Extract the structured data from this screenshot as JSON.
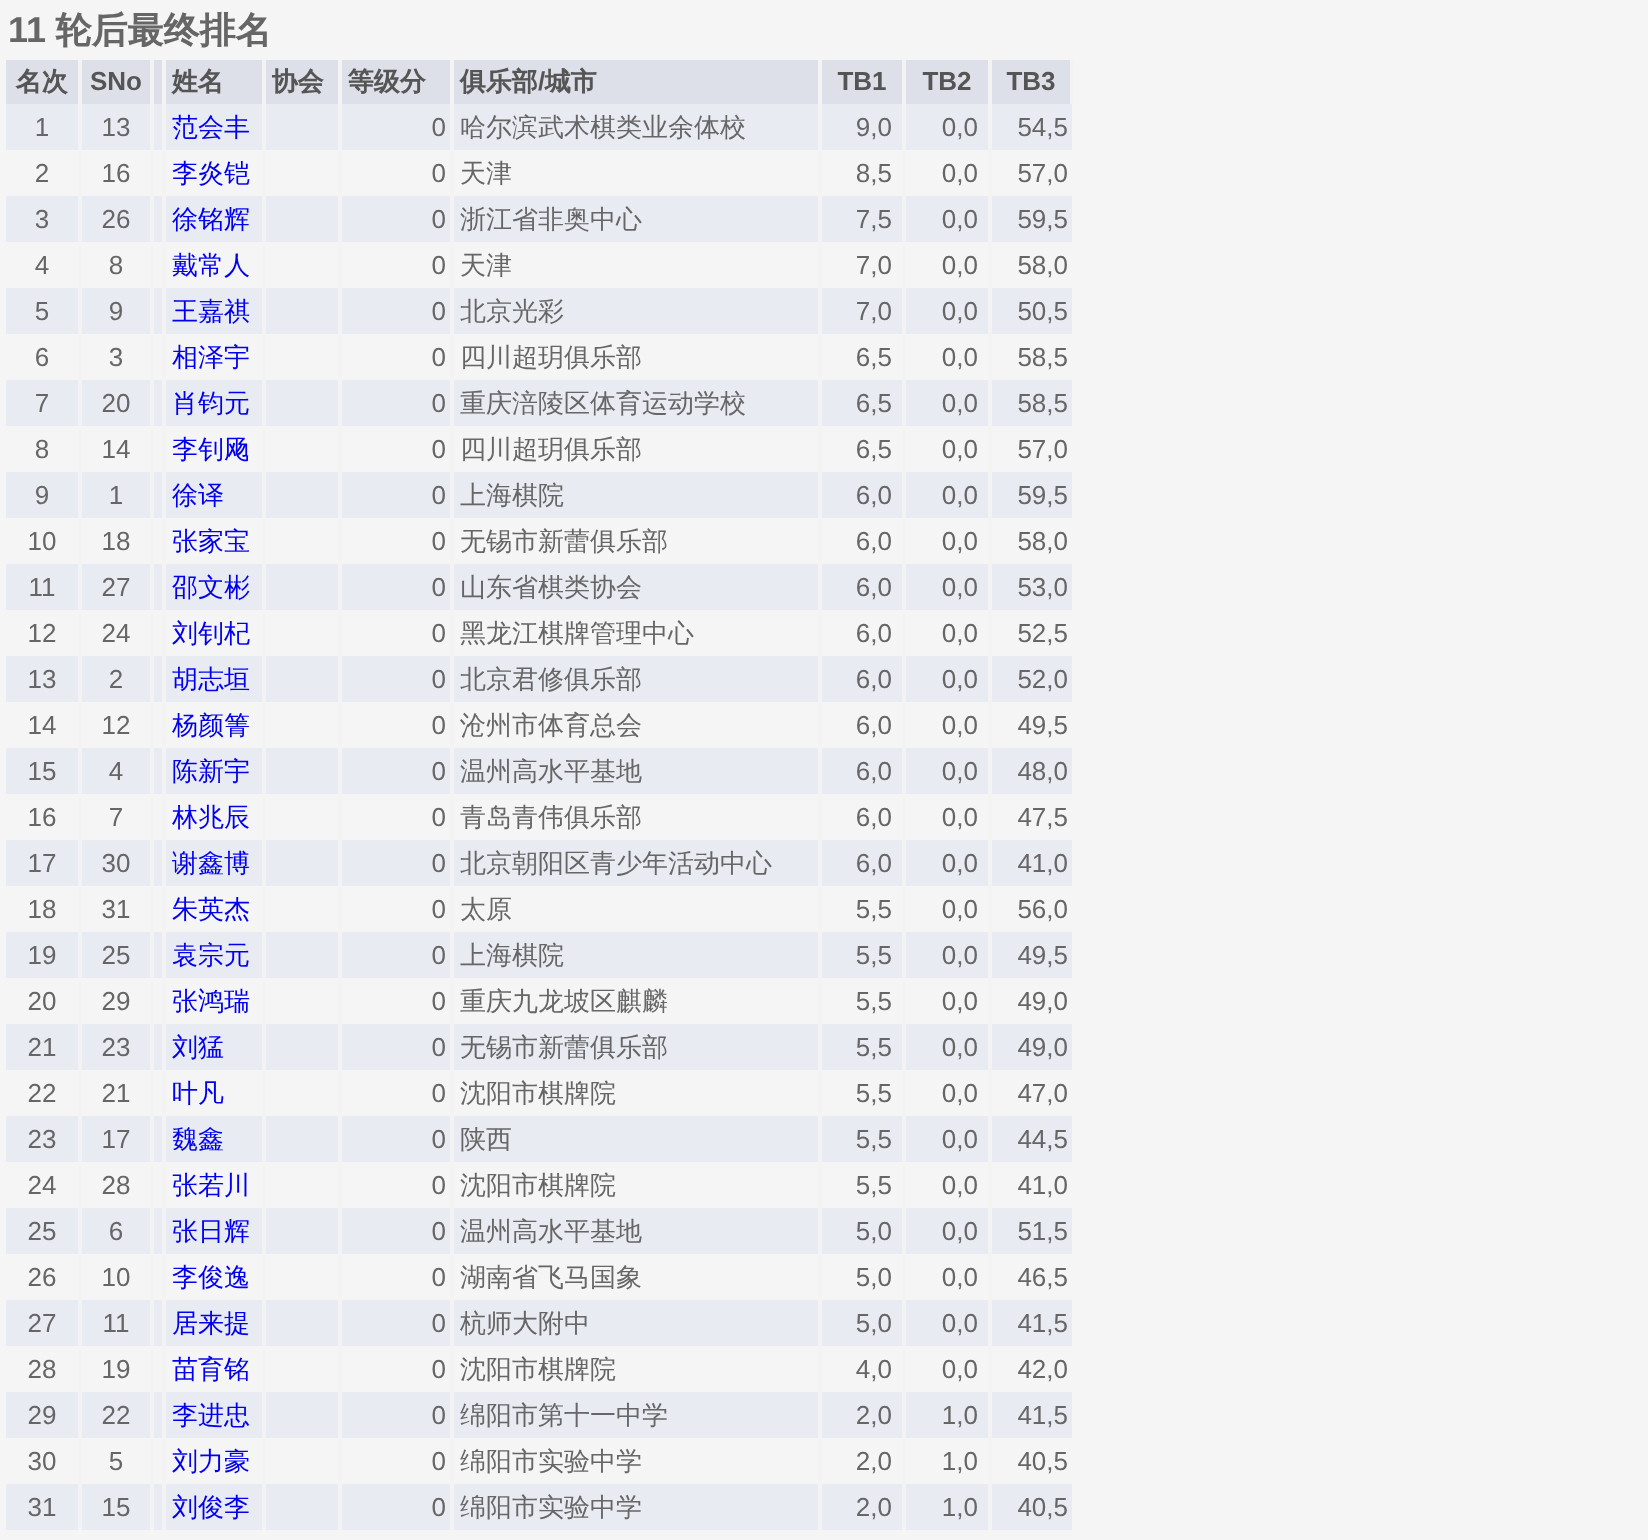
{
  "title": "11 轮后最终排名",
  "table": {
    "columns": [
      "名次",
      "SNo",
      "姓名",
      "协会",
      "等级分",
      "俱乐部/城市",
      "TB1",
      "TB2",
      "TB3"
    ],
    "rows": [
      {
        "rank": "1",
        "sno": "13",
        "name": "范会丰",
        "rating": "0",
        "club": "哈尔滨武术棋类业余体校",
        "tb1": "9,0",
        "tb2": "0,0",
        "tb3": "54,5"
      },
      {
        "rank": "2",
        "sno": "16",
        "name": "李炎铠",
        "rating": "0",
        "club": "天津",
        "tb1": "8,5",
        "tb2": "0,0",
        "tb3": "57,0"
      },
      {
        "rank": "3",
        "sno": "26",
        "name": "徐铭辉",
        "rating": "0",
        "club": "浙江省非奥中心",
        "tb1": "7,5",
        "tb2": "0,0",
        "tb3": "59,5"
      },
      {
        "rank": "4",
        "sno": "8",
        "name": "戴常人",
        "rating": "0",
        "club": "天津",
        "tb1": "7,0",
        "tb2": "0,0",
        "tb3": "58,0"
      },
      {
        "rank": "5",
        "sno": "9",
        "name": "王嘉祺",
        "rating": "0",
        "club": "北京光彩",
        "tb1": "7,0",
        "tb2": "0,0",
        "tb3": "50,5"
      },
      {
        "rank": "6",
        "sno": "3",
        "name": "相泽宇",
        "rating": "0",
        "club": "四川超玥俱乐部",
        "tb1": "6,5",
        "tb2": "0,0",
        "tb3": "58,5"
      },
      {
        "rank": "7",
        "sno": "20",
        "name": "肖钧元",
        "rating": "0",
        "club": "重庆涪陵区体育运动学校",
        "tb1": "6,5",
        "tb2": "0,0",
        "tb3": "58,5"
      },
      {
        "rank": "8",
        "sno": "14",
        "name": "李钊飏",
        "rating": "0",
        "club": "四川超玥俱乐部",
        "tb1": "6,5",
        "tb2": "0,0",
        "tb3": "57,0"
      },
      {
        "rank": "9",
        "sno": "1",
        "name": "徐译",
        "rating": "0",
        "club": "上海棋院",
        "tb1": "6,0",
        "tb2": "0,0",
        "tb3": "59,5"
      },
      {
        "rank": "10",
        "sno": "18",
        "name": "张家宝",
        "rating": "0",
        "club": "无锡市新蕾俱乐部",
        "tb1": "6,0",
        "tb2": "0,0",
        "tb3": "58,0"
      },
      {
        "rank": "11",
        "sno": "27",
        "name": "邵文彬",
        "rating": "0",
        "club": "山东省棋类协会",
        "tb1": "6,0",
        "tb2": "0,0",
        "tb3": "53,0"
      },
      {
        "rank": "12",
        "sno": "24",
        "name": "刘钊杞",
        "rating": "0",
        "club": "黑龙江棋牌管理中心",
        "tb1": "6,0",
        "tb2": "0,0",
        "tb3": "52,5"
      },
      {
        "rank": "13",
        "sno": "2",
        "name": "胡志垣",
        "rating": "0",
        "club": "北京君修俱乐部",
        "tb1": "6,0",
        "tb2": "0,0",
        "tb3": "52,0"
      },
      {
        "rank": "14",
        "sno": "12",
        "name": "杨颜箐",
        "rating": "0",
        "club": "沧州市体育总会",
        "tb1": "6,0",
        "tb2": "0,0",
        "tb3": "49,5"
      },
      {
        "rank": "15",
        "sno": "4",
        "name": "陈新宇",
        "rating": "0",
        "club": "温州高水平基地",
        "tb1": "6,0",
        "tb2": "0,0",
        "tb3": "48,0"
      },
      {
        "rank": "16",
        "sno": "7",
        "name": "林兆辰",
        "rating": "0",
        "club": "青岛青伟俱乐部",
        "tb1": "6,0",
        "tb2": "0,0",
        "tb3": "47,5"
      },
      {
        "rank": "17",
        "sno": "30",
        "name": "谢鑫博",
        "rating": "0",
        "club": "北京朝阳区青少年活动中心",
        "tb1": "6,0",
        "tb2": "0,0",
        "tb3": "41,0"
      },
      {
        "rank": "18",
        "sno": "31",
        "name": "朱英杰",
        "rating": "0",
        "club": "太原",
        "tb1": "5,5",
        "tb2": "0,0",
        "tb3": "56,0"
      },
      {
        "rank": "19",
        "sno": "25",
        "name": "袁宗元",
        "rating": "0",
        "club": "上海棋院",
        "tb1": "5,5",
        "tb2": "0,0",
        "tb3": "49,5"
      },
      {
        "rank": "20",
        "sno": "29",
        "name": "张鸿瑞",
        "rating": "0",
        "club": "重庆九龙坡区麒麟",
        "tb1": "5,5",
        "tb2": "0,0",
        "tb3": "49,0"
      },
      {
        "rank": "21",
        "sno": "23",
        "name": "刘猛",
        "rating": "0",
        "club": "无锡市新蕾俱乐部",
        "tb1": "5,5",
        "tb2": "0,0",
        "tb3": "49,0"
      },
      {
        "rank": "22",
        "sno": "21",
        "name": "叶凡",
        "rating": "0",
        "club": "沈阳市棋牌院",
        "tb1": "5,5",
        "tb2": "0,0",
        "tb3": "47,0"
      },
      {
        "rank": "23",
        "sno": "17",
        "name": "魏鑫",
        "rating": "0",
        "club": "陕西",
        "tb1": "5,5",
        "tb2": "0,0",
        "tb3": "44,5"
      },
      {
        "rank": "24",
        "sno": "28",
        "name": "张若川",
        "rating": "0",
        "club": "沈阳市棋牌院",
        "tb1": "5,5",
        "tb2": "0,0",
        "tb3": "41,0"
      },
      {
        "rank": "25",
        "sno": "6",
        "name": "张日辉",
        "rating": "0",
        "club": "温州高水平基地",
        "tb1": "5,0",
        "tb2": "0,0",
        "tb3": "51,5"
      },
      {
        "rank": "26",
        "sno": "10",
        "name": "李俊逸",
        "rating": "0",
        "club": "湖南省飞马国象",
        "tb1": "5,0",
        "tb2": "0,0",
        "tb3": "46,5"
      },
      {
        "rank": "27",
        "sno": "11",
        "name": "居来提",
        "rating": "0",
        "club": "杭师大附中",
        "tb1": "5,0",
        "tb2": "0,0",
        "tb3": "41,5"
      },
      {
        "rank": "28",
        "sno": "19",
        "name": "苗育铭",
        "rating": "0",
        "club": "沈阳市棋牌院",
        "tb1": "4,0",
        "tb2": "0,0",
        "tb3": "42,0"
      },
      {
        "rank": "29",
        "sno": "22",
        "name": "李进忠",
        "rating": "0",
        "club": "绵阳市第十一中学",
        "tb1": "2,0",
        "tb2": "1,0",
        "tb3": "41,5"
      },
      {
        "rank": "30",
        "sno": "5",
        "name": "刘力豪",
        "rating": "0",
        "club": "绵阳市实验中学",
        "tb1": "2,0",
        "tb2": "1,0",
        "tb3": "40,5"
      },
      {
        "rank": "31",
        "sno": "15",
        "name": "刘俊李",
        "rating": "0",
        "club": "绵阳市实验中学",
        "tb1": "2,0",
        "tb2": "1,0",
        "tb3": "40,5"
      }
    ]
  }
}
